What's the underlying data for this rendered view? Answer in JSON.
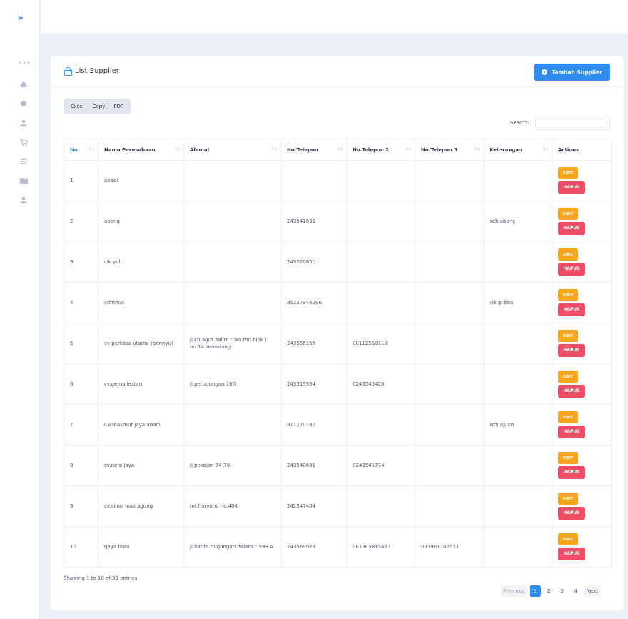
{
  "sidebar": {
    "toggle": "»",
    "dots": "•••"
  },
  "card": {
    "title": "List Supplier",
    "add_label": "Tambah Supplier"
  },
  "exports": [
    "Excel",
    "Copy",
    "PDF"
  ],
  "search": {
    "label": "Search:",
    "value": ""
  },
  "table": {
    "headers": [
      "No",
      "Nama Perusahaan",
      "Alamat",
      "No.Telepon",
      "No.Telepon 2",
      "No.Telepon 3",
      "Keterangan",
      "Actions"
    ],
    "edit_label": "EDIT",
    "delete_label": "HAPUS",
    "rows": [
      [
        "1",
        "abadi",
        "",
        "",
        "",
        "",
        ""
      ],
      [
        "2",
        "abong",
        "",
        "243541631",
        "",
        "",
        "koh abong"
      ],
      [
        "3",
        "cik yuli",
        "",
        "243520850",
        "",
        "",
        ""
      ],
      [
        "4",
        "commal",
        "",
        "85227346296",
        "",
        "",
        "cik priska"
      ],
      [
        "5",
        "cv perkasa utama (pennyu)",
        "jl.kh agus salim ruko thd blok D no 14 semarang",
        "243556166",
        "08112558118",
        "",
        ""
      ],
      [
        "6",
        "cv.gema lestari",
        "jl.petudungan 100",
        "243515954",
        "0243545420",
        "",
        ""
      ],
      [
        "7",
        "CV.makmur jaya abadi",
        "",
        "811270187",
        "",
        "",
        "koh ajuan"
      ],
      [
        "8",
        "cv.nefo jaya",
        "jl.pekojan 74-76",
        "243540681",
        "0243541774",
        "",
        ""
      ],
      [
        "9",
        "cv.sinar mas agung",
        "mt.haryono no.404",
        "242547404",
        "",
        "",
        ""
      ],
      [
        "10",
        "gaya baru",
        "jl.barito bugangan dalam c 593 A",
        "243569979",
        "081805815477",
        "081901702511",
        ""
      ]
    ]
  },
  "footer": {
    "info": "Showing 1 to 10 of 33 entries",
    "previous": "Previous",
    "pages": [
      "1",
      "2",
      "3",
      "4"
    ],
    "next": "Next"
  }
}
